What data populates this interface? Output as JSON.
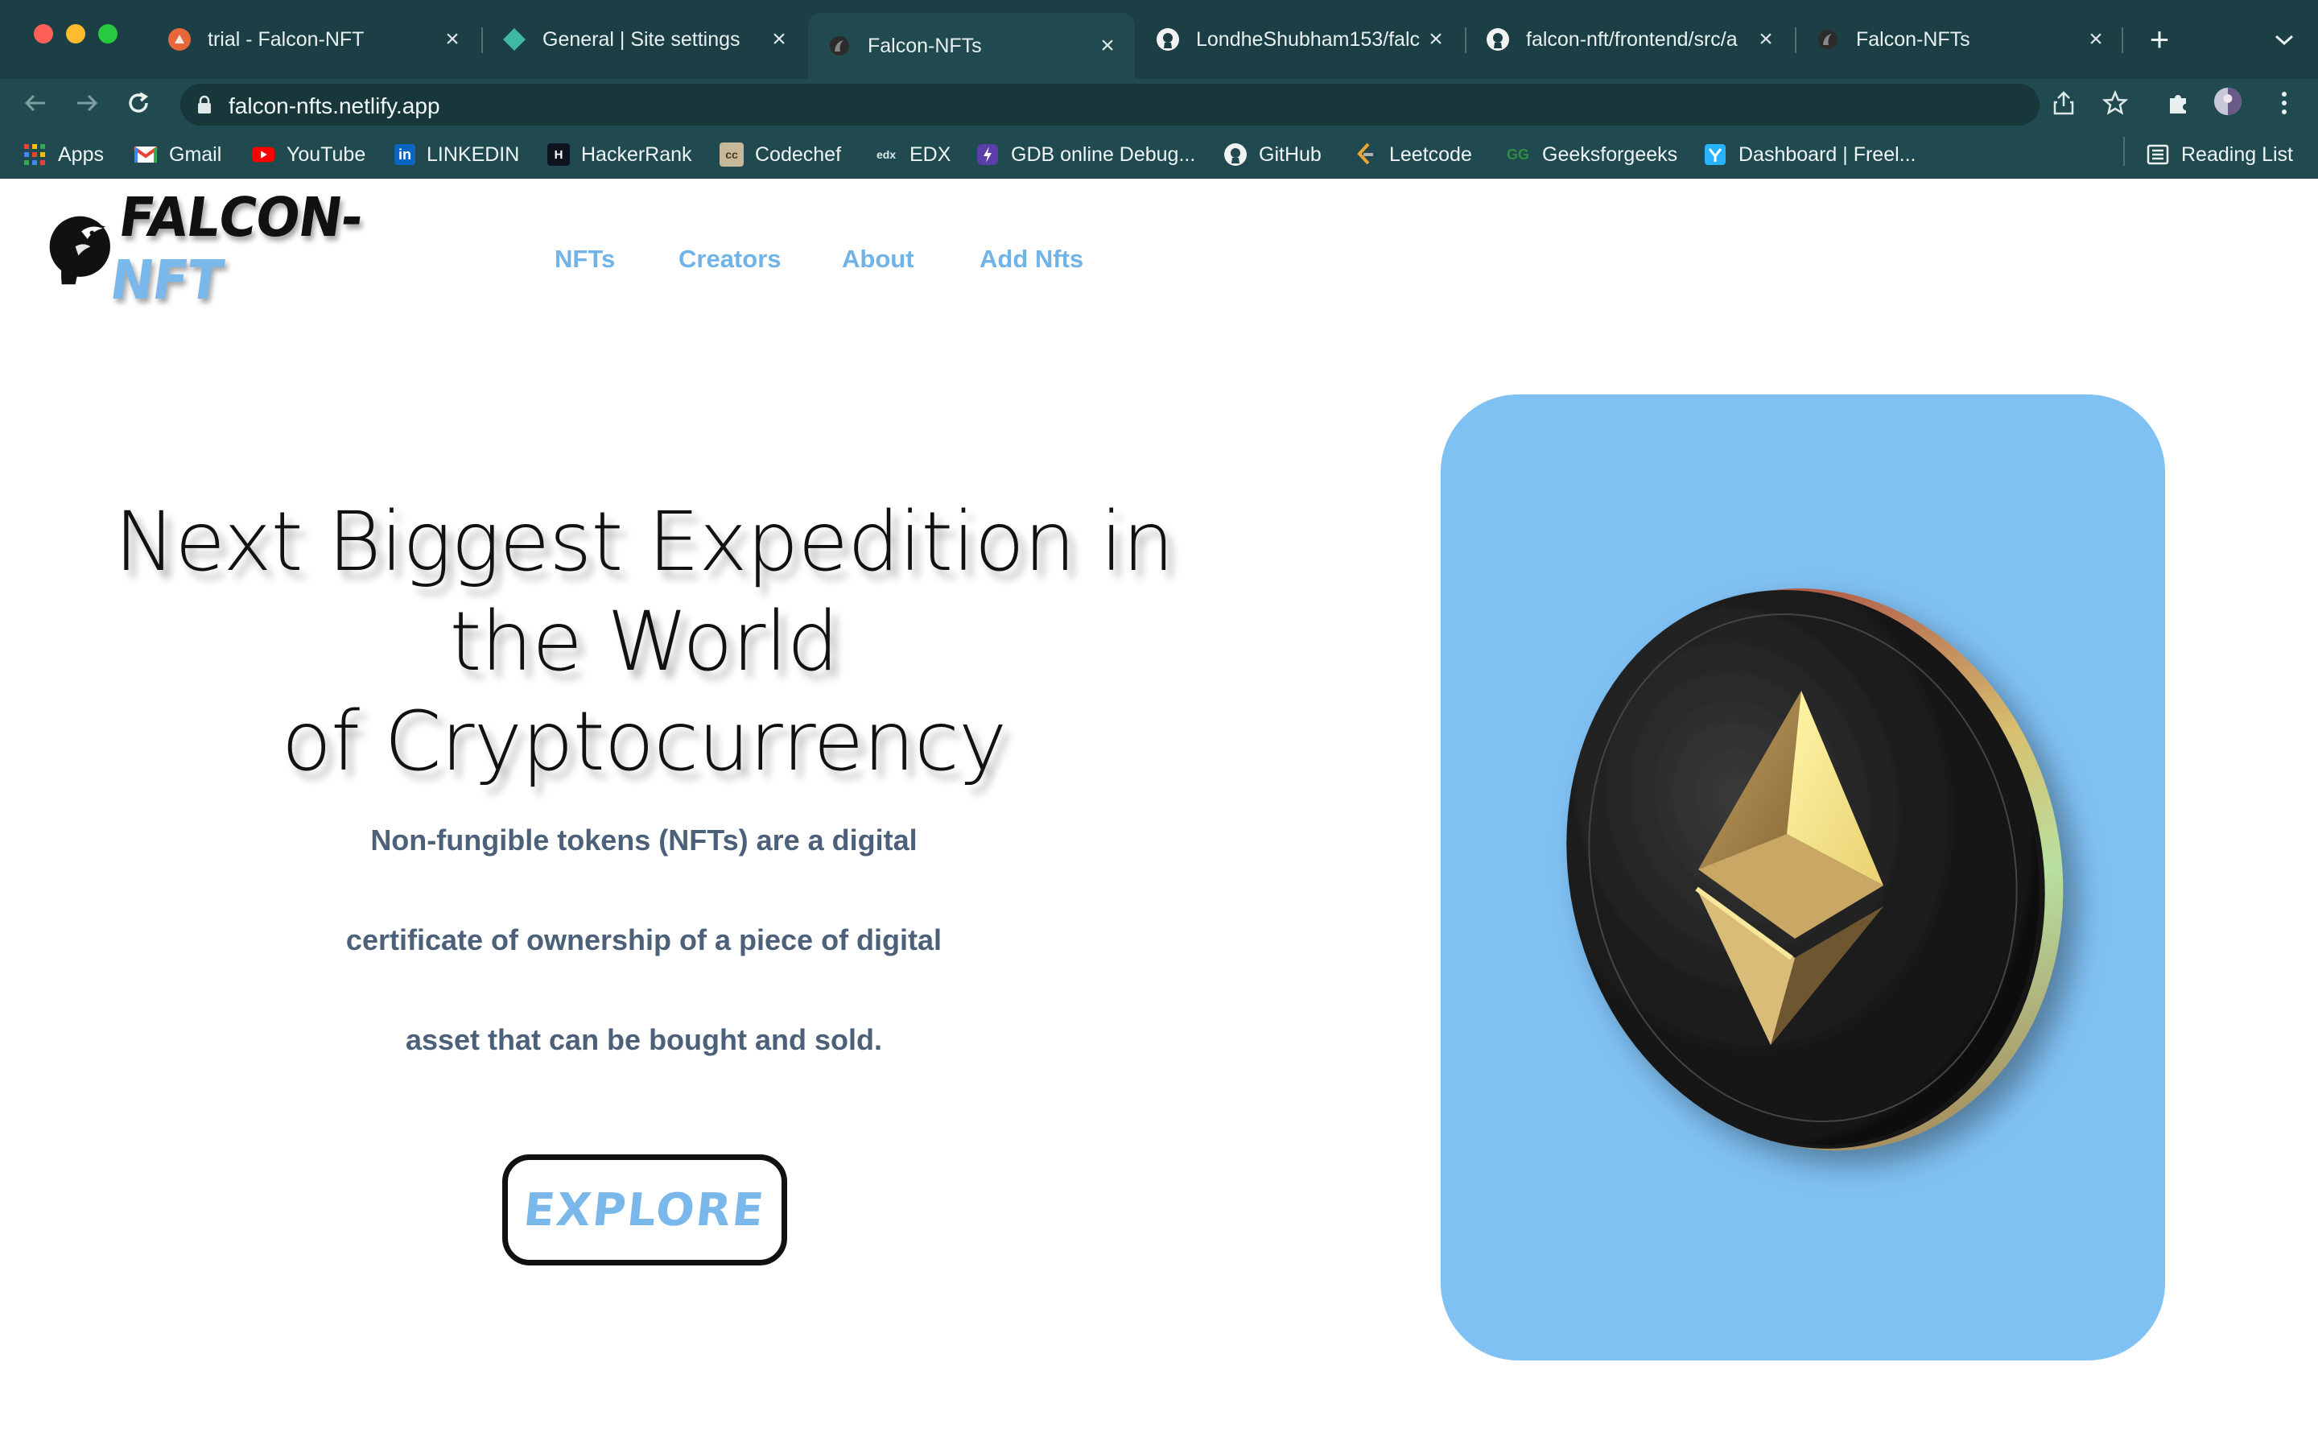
{
  "browser": {
    "tabs": [
      {
        "title": "trial - Falcon-NFT",
        "active": false
      },
      {
        "title": "General | Site settings",
        "active": false
      },
      {
        "title": "Falcon-NFTs",
        "active": true
      },
      {
        "title": "LondheShubham153/falc",
        "active": false
      },
      {
        "title": "falcon-nft/frontend/src/a",
        "active": false
      },
      {
        "title": "Falcon-NFTs",
        "active": false
      }
    ],
    "url": "falcon-nfts.netlify.app",
    "bookmarks": [
      {
        "label": "Apps",
        "icon": "apps-grid-icon"
      },
      {
        "label": "Gmail",
        "icon": "gmail-icon"
      },
      {
        "label": "YouTube",
        "icon": "youtube-icon"
      },
      {
        "label": "LINKEDIN",
        "icon": "linkedin-icon"
      },
      {
        "label": "HackerRank",
        "icon": "hackerrank-icon"
      },
      {
        "label": "Codechef",
        "icon": "codechef-icon"
      },
      {
        "label": "EDX",
        "icon": "edx-icon"
      },
      {
        "label": "GDB online Debug...",
        "icon": "gdb-icon"
      },
      {
        "label": "GitHub",
        "icon": "github-icon"
      },
      {
        "label": "Leetcode",
        "icon": "leetcode-icon"
      },
      {
        "label": "Geeksforgeeks",
        "icon": "gfg-icon"
      },
      {
        "label": "Dashboard | Freel...",
        "icon": "freelancer-icon"
      }
    ],
    "reading_list": "Reading List"
  },
  "site": {
    "logo": {
      "part1": "FALCON-",
      "part2": "NFT"
    },
    "nav": [
      "NFTs",
      "Creators",
      "About",
      "Add Nfts"
    ],
    "hero": {
      "title_lines": [
        "Next Biggest Expedition in",
        "the World",
        "of Cryptocurrency"
      ],
      "description_lines": [
        "Non-fungible tokens (NFTs) are a digital",
        "certificate of ownership of a piece of digital",
        "asset that can be bought and sold."
      ],
      "cta": "EXPLORE"
    },
    "colors": {
      "accent": "#7ab8eb",
      "card": "#80c1f4",
      "chrome": "#204a4f"
    }
  }
}
